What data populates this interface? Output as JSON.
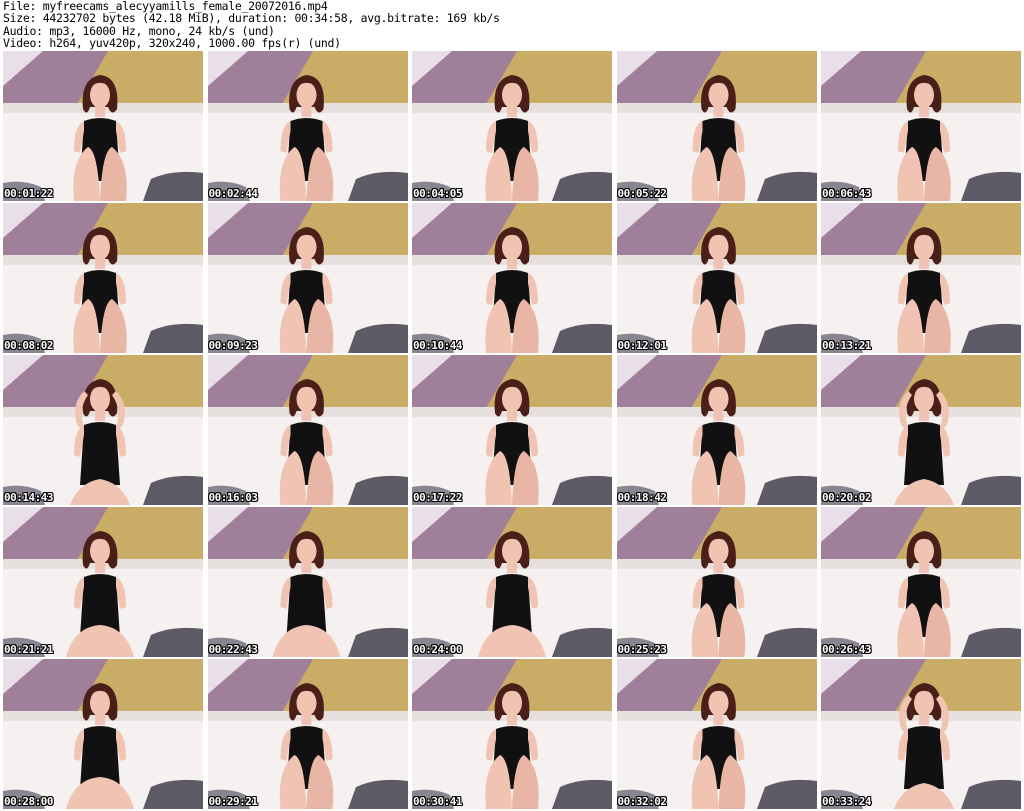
{
  "header": {
    "file_line": "File: myfreecams_alecyyamills_female_20072016.mp4",
    "size_line": "Size: 44232702 bytes (42.18 MiB), duration: 00:34:58, avg.bitrate: 169 kb/s",
    "audio_line": "Audio: mp3, 16000 Hz, mono, 24 kb/s (und)",
    "video_line": "Video: h264, yuv420p, 320x240, 1000.00 fps(r) (und)"
  },
  "colors": {
    "wall_gold": "#c9ac66",
    "wall_purple": "#a07f9a",
    "sofa_white": "#f4f1f0",
    "cushion_grey": "#5e5a66",
    "hair": "#4a1f17",
    "skin": "#f1c3b3",
    "dress": "#111111"
  },
  "thumbnails": [
    {
      "time": "00:01:22",
      "pose": "knees"
    },
    {
      "time": "00:02:44",
      "pose": "knees"
    },
    {
      "time": "00:04:05",
      "pose": "knees"
    },
    {
      "time": "00:05:22",
      "pose": "knees"
    },
    {
      "time": "00:06:43",
      "pose": "knees"
    },
    {
      "time": "00:08:02",
      "pose": "knees"
    },
    {
      "time": "00:09:23",
      "pose": "knees"
    },
    {
      "time": "00:10:44",
      "pose": "knees"
    },
    {
      "time": "00:12:01",
      "pose": "knees"
    },
    {
      "time": "00:13:21",
      "pose": "knees"
    },
    {
      "time": "00:14:43",
      "pose": "hands-up"
    },
    {
      "time": "00:16:03",
      "pose": "knees"
    },
    {
      "time": "00:17:22",
      "pose": "knees"
    },
    {
      "time": "00:18:42",
      "pose": "knees"
    },
    {
      "time": "00:20:02",
      "pose": "hands-up"
    },
    {
      "time": "00:21:21",
      "pose": "sitting"
    },
    {
      "time": "00:22:43",
      "pose": "sitting"
    },
    {
      "time": "00:24:00",
      "pose": "sitting"
    },
    {
      "time": "00:25:23",
      "pose": "knees"
    },
    {
      "time": "00:26:43",
      "pose": "knees"
    },
    {
      "time": "00:28:00",
      "pose": "sitting"
    },
    {
      "time": "00:29:21",
      "pose": "knees"
    },
    {
      "time": "00:30:41",
      "pose": "knees"
    },
    {
      "time": "00:32:02",
      "pose": "knees"
    },
    {
      "time": "00:33:24",
      "pose": "hands-up"
    }
  ]
}
